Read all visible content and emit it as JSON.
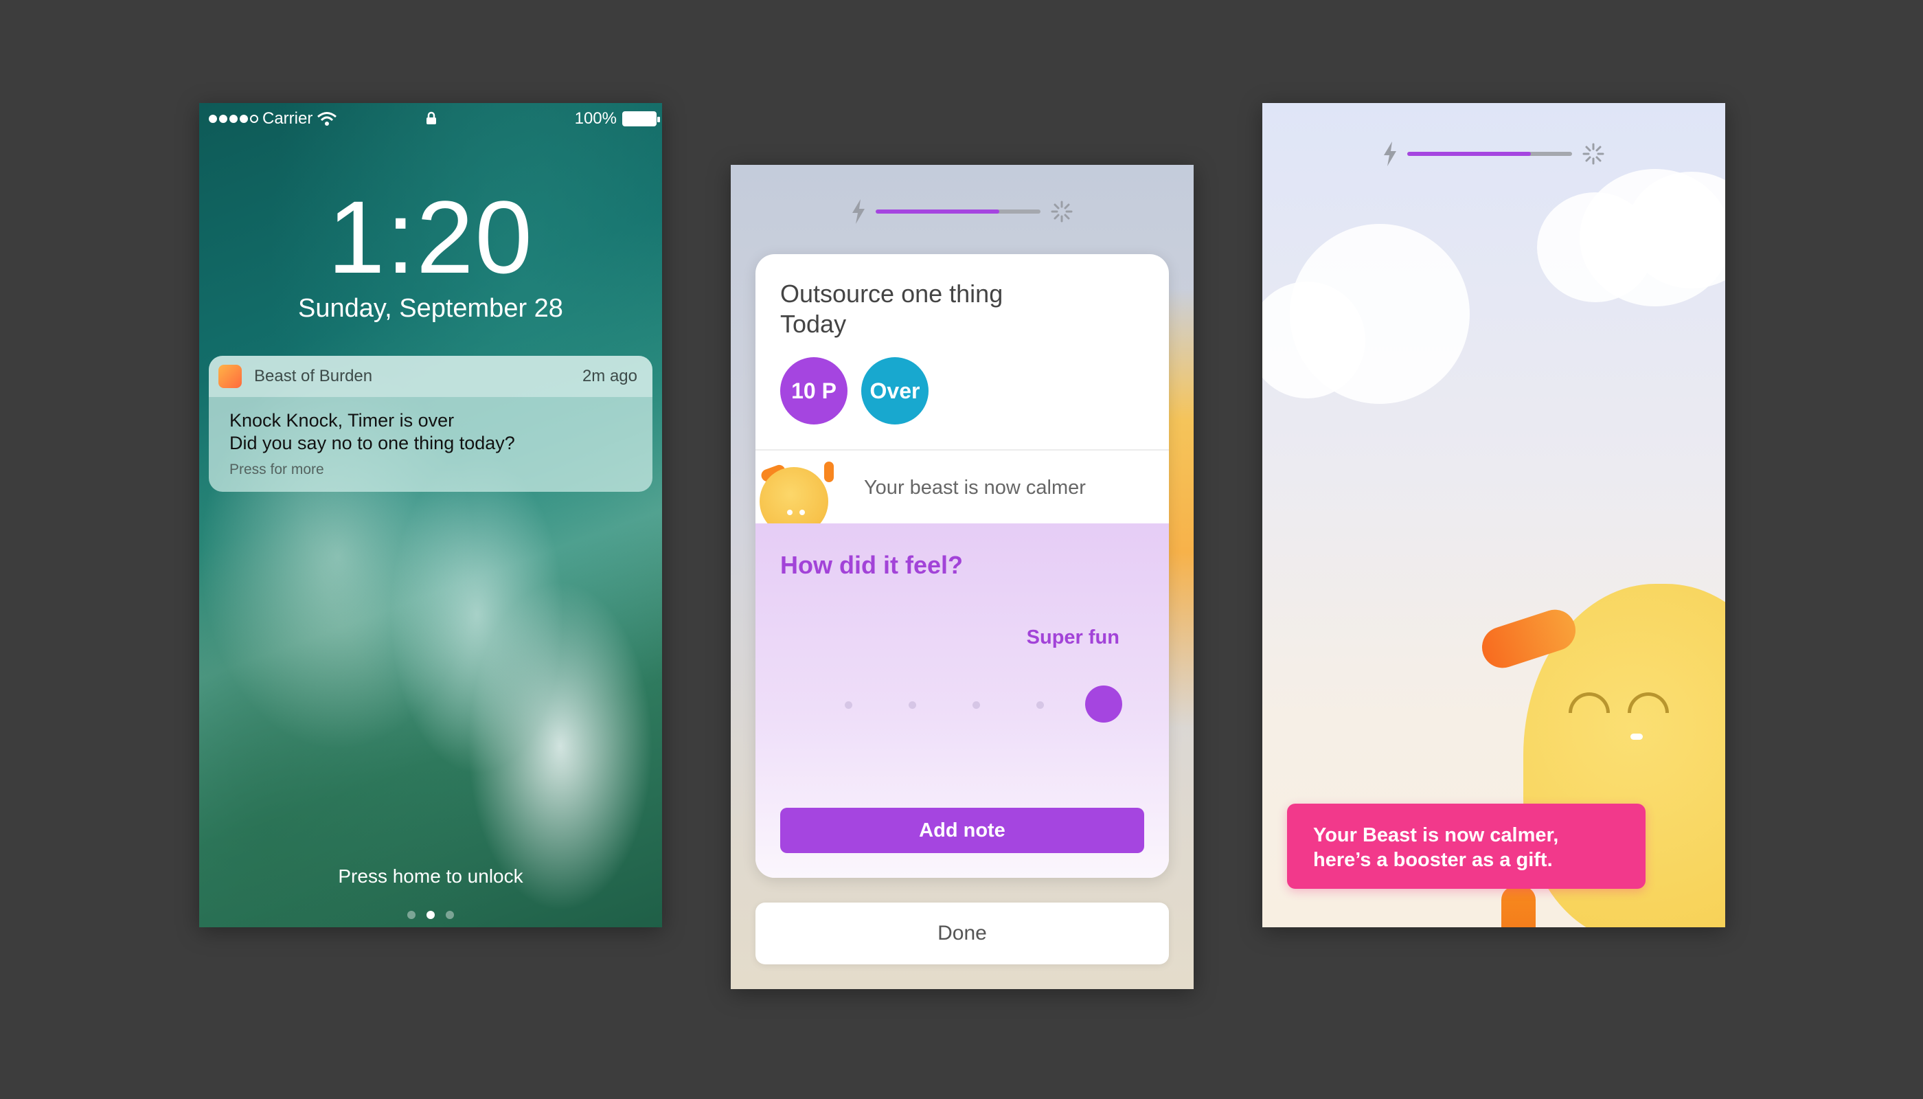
{
  "lock_screen": {
    "status": {
      "carrier": "Carrier",
      "battery": "100%"
    },
    "time": "1:20",
    "date": "Sunday, September 28",
    "notification": {
      "app": "Beast of Burden",
      "time": "2m ago",
      "line1": "Knock Knock, Timer is over",
      "line2": "Did you say no to one thing today?",
      "more": "Press for more"
    },
    "unlock_hint": "Press home to unlock"
  },
  "task_screen": {
    "progress": 0.75,
    "task_title_line1": "Outsource one thing",
    "task_title_line2": "Today",
    "badges": [
      "10 P",
      "Over"
    ],
    "calmer_text": "Your beast is now calmer",
    "feel_title": "How did it feel?",
    "feel_value": "Super fun",
    "feel_level": 5,
    "feel_levels": 5,
    "add_note": "Add note",
    "done": "Done"
  },
  "gift_screen": {
    "progress": 0.75,
    "toast_line1": "Your Beast is now calmer,",
    "toast_line2": "here’s a booster as a gift."
  },
  "colors": {
    "accent_purple": "#a545e0",
    "badge_blue": "#18a8cf",
    "toast_pink": "#f2398b",
    "beast_yellow": "#f6cf52",
    "beast_orange": "#f86b1f",
    "background": "#3d3d3d"
  },
  "icons": [
    "wifi-icon",
    "lock-icon",
    "battery-icon",
    "app-icon",
    "bolt-icon",
    "spinner-icon"
  ]
}
